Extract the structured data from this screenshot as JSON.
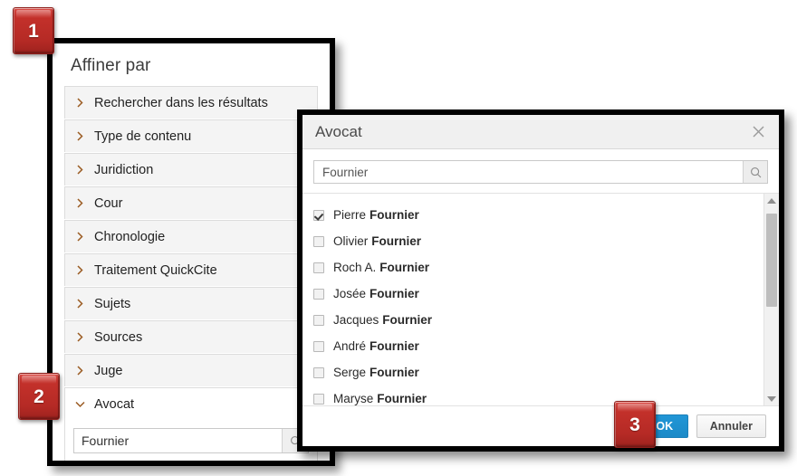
{
  "callouts": [
    {
      "label": "1"
    },
    {
      "label": "2"
    },
    {
      "label": "3"
    }
  ],
  "refine_panel": {
    "title": "Affiner par",
    "facets": [
      {
        "label": "Rechercher dans les résultats",
        "expanded": false
      },
      {
        "label": "Type de contenu",
        "expanded": false
      },
      {
        "label": "Juridiction",
        "expanded": false
      },
      {
        "label": "Cour",
        "expanded": false
      },
      {
        "label": "Chronologie",
        "expanded": false
      },
      {
        "label": "Traitement QuickCite",
        "expanded": false
      },
      {
        "label": "Sujets",
        "expanded": false
      },
      {
        "label": "Sources",
        "expanded": false
      },
      {
        "label": "Juge",
        "expanded": false
      },
      {
        "label": "Avocat",
        "expanded": true
      }
    ],
    "facet_search": {
      "value": "Fournier",
      "placeholder": "Fournier",
      "icon": "search-icon"
    }
  },
  "dialog": {
    "title": "Avocat",
    "close_icon": "close-icon",
    "search": {
      "value": "Fournier",
      "placeholder": "Fournier",
      "icon": "search-icon"
    },
    "options": [
      {
        "first": "Pierre",
        "last": "Fournier",
        "checked": true
      },
      {
        "first": "Olivier",
        "last": "Fournier",
        "checked": false
      },
      {
        "first": "Roch A.",
        "last": "Fournier",
        "checked": false
      },
      {
        "first": "Josée",
        "last": "Fournier",
        "checked": false
      },
      {
        "first": "Jacques",
        "last": "Fournier",
        "checked": false
      },
      {
        "first": "André",
        "last": "Fournier",
        "checked": false
      },
      {
        "first": "Serge",
        "last": "Fournier",
        "checked": false
      },
      {
        "first": "Maryse",
        "last": "Fournier",
        "checked": false
      }
    ],
    "scrollbar": {
      "up_icon": "caret-up-icon",
      "down_icon": "caret-down-icon",
      "thumb_top_pct": 3,
      "thumb_height_pct": 44
    },
    "buttons": {
      "ok": "OK",
      "cancel": "Annuler"
    }
  },
  "colors": {
    "callout_red": "#c4312b",
    "ok_blue": "#2196d6",
    "chevron_orange": "#9a5b22",
    "frame_black": "#000000"
  }
}
